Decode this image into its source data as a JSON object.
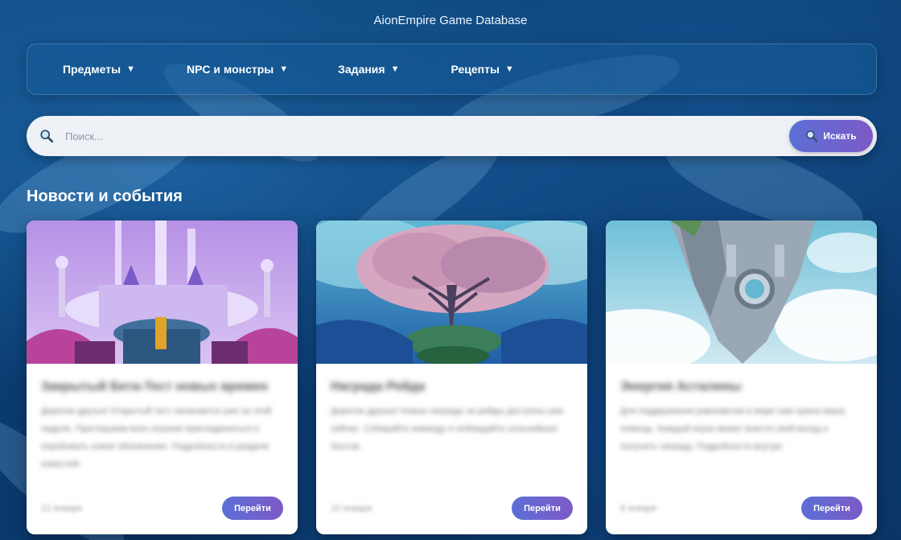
{
  "site": {
    "title": "AionEmpire Game Database"
  },
  "nav": {
    "items": [
      {
        "label": "Предметы",
        "caret": "▼"
      },
      {
        "label": "NPC и монстры",
        "caret": "▼"
      },
      {
        "label": "Задания",
        "caret": "▼"
      },
      {
        "label": "Рецепты",
        "caret": "▼"
      }
    ]
  },
  "search": {
    "placeholder": "Поиск...",
    "button_label": "Искать",
    "icon": "magnifier-icon"
  },
  "news": {
    "title": "Новости и события",
    "cards": [
      {
        "title": "Закрытый Бета-Тест новых времен",
        "text": "Дорогие друзья! Открытый тест начинается уже на этой неделе. Приглашаем всех игроков присоединиться и опробовать новое обновление. Подробности в разделе новостей.",
        "date": "12 января",
        "button_label": "Перейти"
      },
      {
        "title": "Награда Рейда",
        "text": "Дорогие друзья! Новые награды за рейды доступны уже сейчас. Собирайте команду и побеждайте сильнейших боссов.",
        "date": "10 января",
        "button_label": "Перейти"
      },
      {
        "title": "Энергия Асталины",
        "text": "Для поддержания равновесия в мире нам нужна ваша помощь. Каждый игрок может внести свой вклад и получить награду. Подробности внутри.",
        "date": "8 января",
        "button_label": "Перейти"
      }
    ]
  }
}
